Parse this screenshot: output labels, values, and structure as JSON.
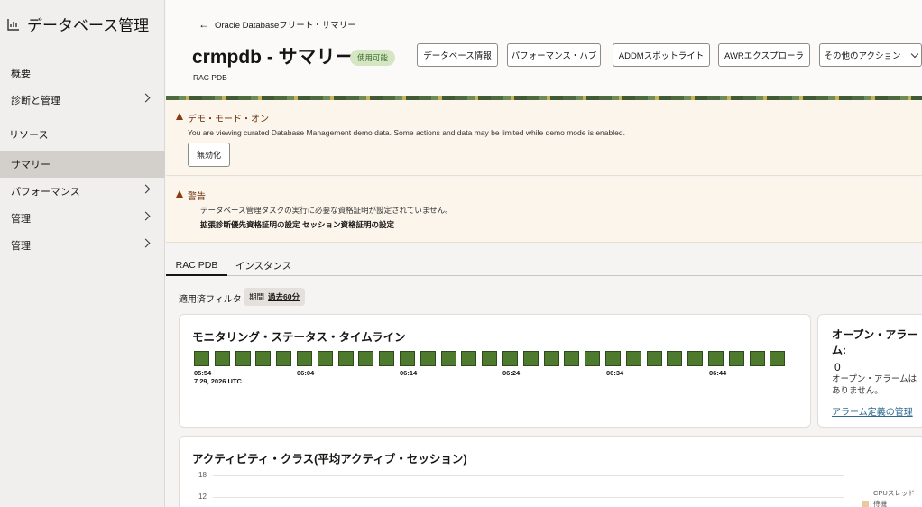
{
  "sidebar": {
    "title": "データベース管理",
    "items": [
      {
        "label": "概要"
      },
      {
        "label": "診断と管理"
      },
      {
        "label": "リソース"
      },
      {
        "label": "サマリー"
      },
      {
        "label": "パフォーマンス"
      },
      {
        "label": "管理"
      },
      {
        "label": "管理"
      }
    ]
  },
  "header": {
    "back_link": "Oracle Databaseフリート・サマリー",
    "title": "crmpdb - サマリー",
    "status": "使用可能",
    "subtitle": "RAC PDB",
    "buttons": {
      "db_info": "データベース情報",
      "perf_hub": "パフォーマンス・ハブ",
      "addm": "ADDMスポットライト",
      "awr": "AWRエクスプローラ",
      "more": "その他のアクション"
    }
  },
  "demo_banner": {
    "title": "デモ・モード・オン",
    "text": "You are viewing curated Database Management demo data. Some actions and data may be limited while demo mode is enabled.",
    "button": "無効化"
  },
  "warning_banner": {
    "title": "警告",
    "text": "データベース管理タスクの実行に必要な資格証明が設定されていません。",
    "links": [
      "拡張診断優先資格証明の設定",
      "セッション資格証明の設定"
    ]
  },
  "tabs": [
    "RAC PDB",
    "インスタンス"
  ],
  "filter": {
    "label": "適用済フィルタ",
    "key": "期間",
    "value": "過去60分"
  },
  "timeline": {
    "title": "モニタリング・ステータス・タイムライン",
    "cell_count": 29,
    "cell_color": "#4e7a2e",
    "time_labels": [
      "05:54",
      "06:04",
      "06:14",
      "06:24",
      "06:34",
      "06:44"
    ],
    "date_label": "7 29, 2026 UTC"
  },
  "alarms": {
    "title": "オープン・アラーム:",
    "count": "0",
    "description": "オープン・アラームはありません。",
    "link": "アラーム定義の管理"
  },
  "activity": {
    "title": "アクティビティ・クラス(平均アクティブ・セッション)",
    "y_ticks": [
      "18",
      "12"
    ],
    "legend": [
      "CPUスレッド",
      "待機"
    ]
  }
}
